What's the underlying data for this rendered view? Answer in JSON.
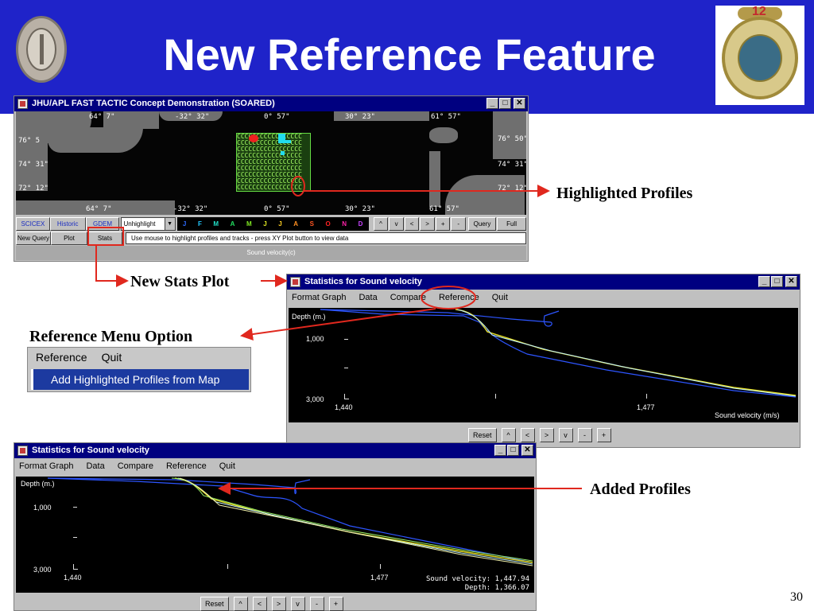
{
  "slide": {
    "title": "New Reference Feature",
    "page_number": "30",
    "annotations": {
      "highlighted_profiles": "Highlighted Profiles",
      "new_stats_plot": "New Stats Plot",
      "reference_menu_option": "Reference Menu Option",
      "added_profiles": "Added Profiles"
    },
    "colors": {
      "header": "#1f23c9",
      "callout": "#e0281e"
    }
  },
  "logos": {
    "navy_badge_text": "12"
  },
  "map_window": {
    "title": "JHU/APL FAST TACTIC Concept Demonstration (SOARED)",
    "coords_top": [
      "64° 7\"",
      "-32° 32\"",
      "0° 57\"",
      "30° 23\"",
      "61° 57\""
    ],
    "coords_bottom": [
      "64° 7\"",
      "-32° 32\"",
      "0° 57\"",
      "30° 23\"",
      "61° 57\""
    ],
    "lat_left": [
      "76° 5",
      "74° 31\"",
      "72° 12\""
    ],
    "lat_right": [
      "76° 50\"",
      "74° 31\"",
      "72° 12\""
    ],
    "buttons_row1": [
      "SCICEX",
      "Historic",
      "GDEM"
    ],
    "highlight_combo": "Unhighlight",
    "months": [
      {
        "l": "J",
        "c": "#2d6bff"
      },
      {
        "l": "F",
        "c": "#22c8ff"
      },
      {
        "l": "M",
        "c": "#22e0c8"
      },
      {
        "l": "A",
        "c": "#22e060"
      },
      {
        "l": "M",
        "c": "#7fe822"
      },
      {
        "l": "J",
        "c": "#e0e822"
      },
      {
        "l": "J",
        "c": "#ffd022"
      },
      {
        "l": "A",
        "c": "#ff9022"
      },
      {
        "l": "S",
        "c": "#ff5522"
      },
      {
        "l": "O",
        "c": "#ff2222"
      },
      {
        "l": "N",
        "c": "#ff22aa"
      },
      {
        "l": "D",
        "c": "#c844ff"
      }
    ],
    "nav_buttons": [
      "^",
      "v",
      "<",
      ">",
      "+",
      "-"
    ],
    "query_label": "Query",
    "full_label": "Full",
    "buttons_row2": [
      "New Query",
      "Plot",
      "Stats"
    ],
    "status_message": "Use mouse to highlight profiles and tracks - press XY Plot button to view data",
    "footer_label": "Sound velocity(c)",
    "grid_text": "CCCCCCCCCCCCCCCCC"
  },
  "stats_window_1": {
    "title": "Statistics for Sound velocity",
    "menu": [
      "Format Graph",
      "Data",
      "Compare",
      "Reference",
      "Quit"
    ],
    "y_label": "Depth (m.)",
    "y_ticks": [
      "1,000",
      "3,000"
    ],
    "x_ticks": [
      "1,440",
      "1,477"
    ],
    "x_label": "Sound velocity (m/s)",
    "buttons": [
      "Reset",
      "^",
      "<",
      ">",
      "v",
      "-",
      "+"
    ]
  },
  "reference_menu": {
    "items": [
      "Reference",
      "Quit"
    ],
    "option": "Add Highlighted Profiles from Map"
  },
  "stats_window_2": {
    "title": "Statistics for Sound velocity",
    "menu": [
      "Format Graph",
      "Data",
      "Compare",
      "Reference",
      "Quit"
    ],
    "y_label": "Depth (m.)",
    "y_ticks": [
      "1,000",
      "3,000"
    ],
    "x_ticks": [
      "1,440",
      "1,477"
    ],
    "readout_line1": "Sound velocity: 1,447.94",
    "readout_line2": "Depth: 1,366.07",
    "buttons": [
      "Reset",
      "^",
      "<",
      ">",
      "v",
      "-",
      "+"
    ]
  }
}
